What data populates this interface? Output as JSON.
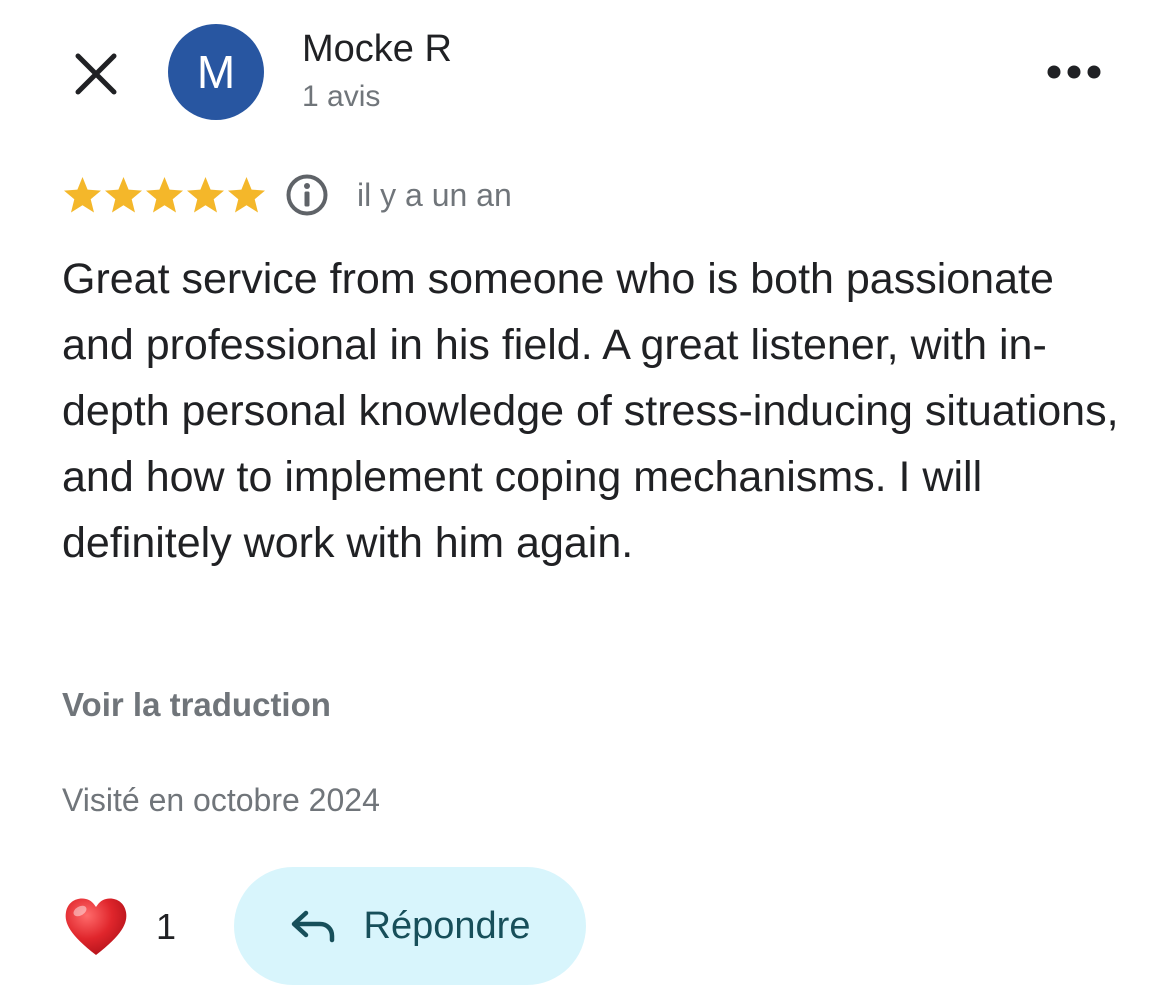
{
  "colors": {
    "avatar_bg": "#2856a1",
    "star": "#f4b72a",
    "reply_bg": "#d8f5fc",
    "reply_fg": "#174f5a",
    "heart": "#e0262c",
    "secondary_text": "#70757a"
  },
  "header": {
    "close_icon": "close-icon",
    "avatar_initial": "M",
    "author_name": "Mocke R",
    "author_meta": "1 avis",
    "more_icon": "more-horizontal-icon"
  },
  "review": {
    "rating": 5,
    "rating_max": 5,
    "info_icon": "info-icon",
    "date": "il y a un an",
    "text": "Great service from someone who is both passionate and professional in his field. A great listener, with in-depth personal knowledge of stress-inducing situations, and how to implement coping mechanisms. I will definitely work with him again.",
    "translate_label": "Voir la traduction",
    "visited": "Visité en octobre 2024"
  },
  "actions": {
    "heart_icon": "heart-icon",
    "like_count": "1",
    "reply_icon": "reply-arrow-icon",
    "reply_label": "Répondre"
  }
}
